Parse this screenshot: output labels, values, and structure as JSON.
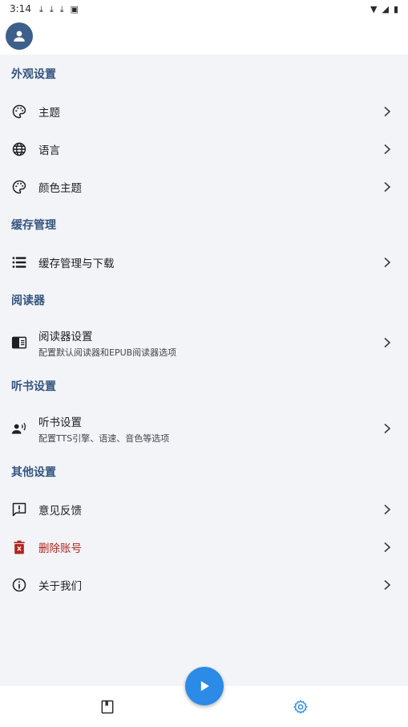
{
  "status_bar": {
    "time": "3:14"
  },
  "sections": [
    {
      "title": "外观设置",
      "items": [
        {
          "title": "主题",
          "icon": "palette-icon"
        },
        {
          "title": "语言",
          "icon": "globe-icon"
        },
        {
          "title": "颜色主题",
          "icon": "palette-icon"
        }
      ]
    },
    {
      "title": "缓存管理",
      "items": [
        {
          "title": "缓存管理与下载",
          "icon": "storage-list-icon"
        }
      ]
    },
    {
      "title": "阅读器",
      "items": [
        {
          "title": "阅读器设置",
          "subtitle": "配置默认阅读器和EPUB阅读器选项",
          "icon": "reader-icon"
        }
      ]
    },
    {
      "title": "听书设置",
      "items": [
        {
          "title": "听书设置",
          "subtitle": "配置TTS引擎、语速、音色等选项",
          "icon": "voice-icon"
        }
      ]
    },
    {
      "title": "其他设置",
      "items": [
        {
          "title": "意见反馈",
          "icon": "feedback-icon"
        },
        {
          "title": "删除账号",
          "icon": "trash-icon",
          "danger": true
        },
        {
          "title": "关于我们",
          "icon": "info-icon"
        }
      ]
    }
  ],
  "colors": {
    "accent": "#35557f",
    "fab": "#2b8be6",
    "danger": "#b3261e",
    "nav_active": "#2b8be6",
    "background": "#f2f4f8"
  }
}
